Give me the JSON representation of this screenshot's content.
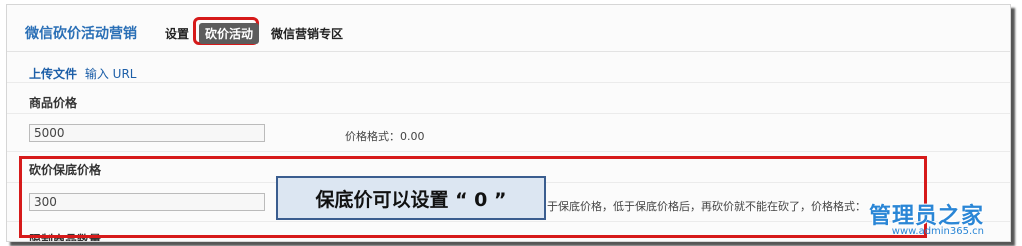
{
  "header": {
    "app_title": "微信砍价活动营销",
    "tabs": [
      {
        "label": "设置"
      },
      {
        "label": "砍价活动"
      },
      {
        "label": "微信营销专区"
      }
    ]
  },
  "upload": {
    "upload_label": "上传文件",
    "url_label": "输入 URL"
  },
  "fields": {
    "price": {
      "label": "商品价格",
      "value": "5000",
      "hint": "价格格式：0.00"
    },
    "floor_price": {
      "label": "砍价保底价格",
      "value": "300",
      "hint": "于保底价格，低于保底价格后，再砍价就不能在砍了，价格格式："
    },
    "limit": {
      "label": "限制商品数量"
    }
  },
  "callout": {
    "text": "保底价可以设置 “ 0 ”"
  },
  "watermark": {
    "logo": "管理员之家",
    "url": "www.admin365.cn"
  },
  "colors": {
    "accent_red": "#d61a1a",
    "link_blue": "#1d5fa8",
    "title_blue": "#2a6fb6",
    "active_tab_bg": "#5c5c5c"
  }
}
